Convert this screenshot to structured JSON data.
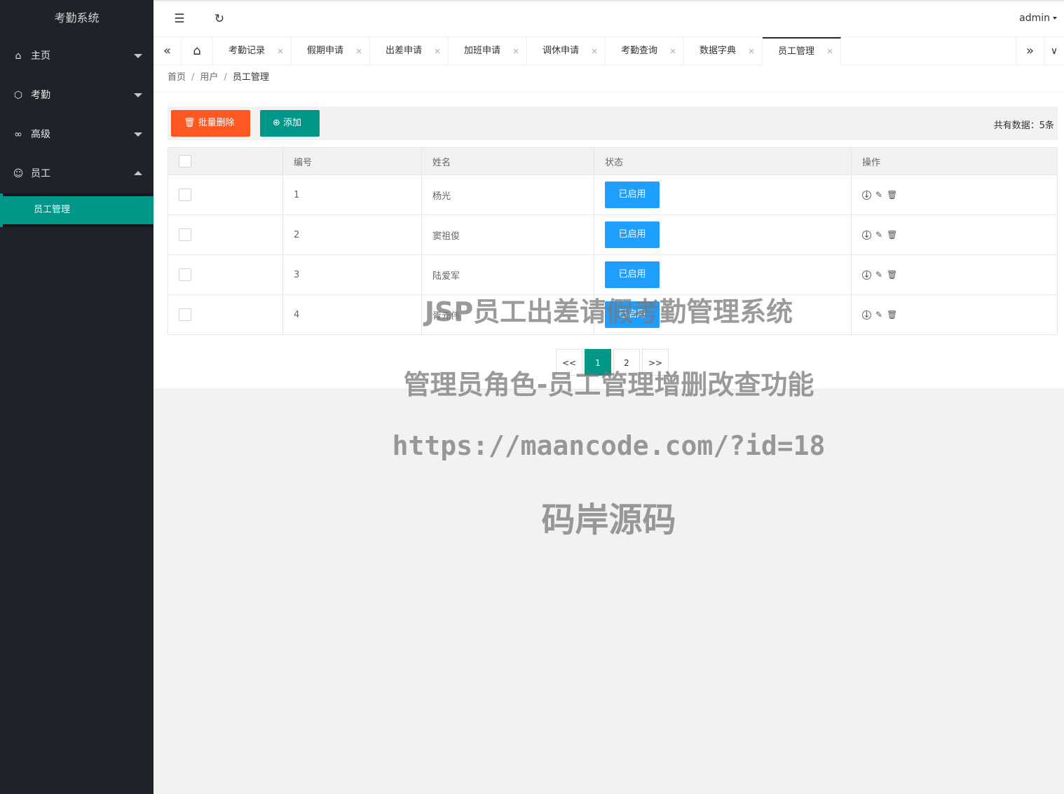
{
  "app": {
    "title": "考勤系统"
  },
  "sidebar": {
    "items": [
      {
        "label": "主页",
        "icon": "home-icon",
        "icon_glyph": "⌂",
        "expanded": false
      },
      {
        "label": "考勤",
        "icon": "box-icon",
        "icon_glyph": "⬡",
        "expanded": false
      },
      {
        "label": "高级",
        "icon": "link-icon",
        "icon_glyph": "∞",
        "expanded": false
      },
      {
        "label": "员工",
        "icon": "user-icon",
        "icon_glyph": "☺",
        "expanded": true
      }
    ],
    "sub_items": [
      {
        "label": "员工管理",
        "active": true
      }
    ]
  },
  "header": {
    "menu_icon": "☰",
    "refresh_icon": "↻",
    "user": "admin"
  },
  "tabs": {
    "prev_glyph": "«",
    "next_glyph": "»",
    "more_glyph": "∨",
    "home_glyph": "⌂",
    "close_glyph": "×",
    "items": [
      {
        "label": "考勤记录"
      },
      {
        "label": "假期申请"
      },
      {
        "label": "出差申请"
      },
      {
        "label": "加班申请"
      },
      {
        "label": "调休申请"
      },
      {
        "label": "考勤查询"
      },
      {
        "label": "数据字典"
      },
      {
        "label": "员工管理",
        "active": true
      }
    ]
  },
  "breadcrumb": {
    "items": [
      "首页",
      "用户",
      "员工管理"
    ],
    "separator": "/"
  },
  "toolbar": {
    "batch_delete_label": "批量删除",
    "batch_delete_icon": "🗑",
    "add_label": "添加",
    "add_icon": "⊕",
    "count_text": "共有数据：5条"
  },
  "table": {
    "headers": [
      "",
      "编号",
      "姓名",
      "状态",
      "操作"
    ],
    "rows": [
      {
        "id": "1",
        "name": "杨光",
        "status": "已启用"
      },
      {
        "id": "2",
        "name": "窦祖俊",
        "status": "已启用"
      },
      {
        "id": "3",
        "name": "陆爱军",
        "status": "已启用"
      },
      {
        "id": "4",
        "name": "胥元伟",
        "status": "已启用"
      }
    ],
    "op_glyphs": {
      "down": "↓",
      "edit": "✎",
      "delete": "🗑"
    }
  },
  "pagination": {
    "prev": "<<",
    "pages": [
      "1",
      "2"
    ],
    "current": "1",
    "next": ">>"
  },
  "watermark": {
    "line1": "JSP员工出差请假考勤管理系统",
    "line2": "管理员角色-员工管理增删改查功能",
    "line3": "https://maancode.com/?id=18",
    "line4": "码岸源码"
  },
  "colors": {
    "sidebar_bg": "#20222A",
    "accent": "#009688",
    "danger": "#FF5722",
    "status_blue": "#1E9FFF"
  }
}
